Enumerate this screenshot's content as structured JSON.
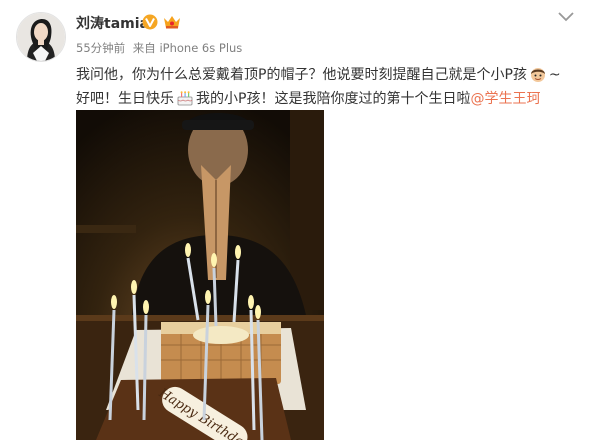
{
  "user": {
    "name": "刘涛tamia"
  },
  "meta": {
    "time": "55分钟前",
    "source": "来自 iPhone 6s Plus"
  },
  "post": {
    "seg1": "我问他，你为什么总爱戴着顶P的帽子？他说要时刻提醒自己就是个小P孩",
    "seg2": "~好吧！生日快乐",
    "seg3": "我的小P孩！这是我陪你度过的第十个生日啦",
    "mention": "@学生王珂"
  },
  "photo": {
    "cake_text": "Happy Birthday"
  },
  "icons": {
    "verified": "verified-v-icon",
    "member": "crown-member-icon",
    "dropdown": "chevron-down-icon",
    "emoji_boy": "boy-face-emoji-icon",
    "emoji_cake": "cake-emoji-icon"
  },
  "colors": {
    "mention": "#eb7350",
    "verified": "#f5a623",
    "text": "#333333",
    "meta": "#808080"
  }
}
